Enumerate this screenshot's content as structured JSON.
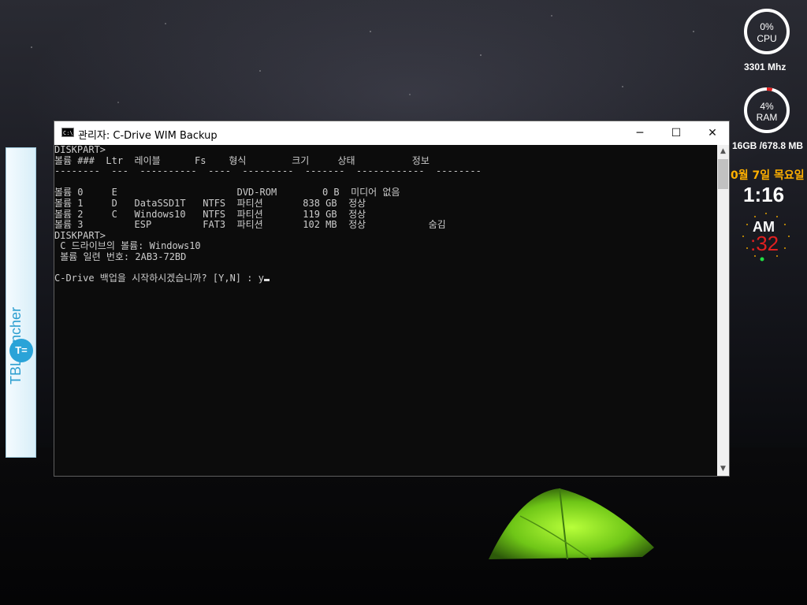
{
  "launcher": {
    "label": "TBLauncher"
  },
  "console_window": {
    "title": "관리자:  C-Drive WIM Backup",
    "minimize": "─",
    "maximize": "☐",
    "close": "✕",
    "lines": [
      "DISKPART>",
      "볼륨 ###  Ltr  레이블      Fs    형식        크기     상태          정보",
      "--------  ---  ----------  ----  ---------  -------  ------------  --------",
      "",
      "볼륨 0     E                     DVD-ROM        0 B  미디어 없음",
      "볼륨 1     D   DataSSD1T   NTFS  파티션       838 GB  정상",
      "볼륨 2     C   Windows10   NTFS  파티션       119 GB  정상",
      "볼륨 3         ESP         FAT3  파티션       102 MB  정상           숨김",
      "DISKPART>",
      " C 드라이브의 볼륨: Windows10",
      " 볼륨 일련 번호: 2AB3-72BD",
      "",
      "C-Drive 백업을 시작하시겠습니까? [Y,N] : y"
    ]
  },
  "gadgets": {
    "cpu": {
      "percent_label": "0%",
      "name": "CPU",
      "speed": "3301 Mhz",
      "usage": 0
    },
    "ram": {
      "percent_label": "4%",
      "name": "RAM",
      "memory": "16GB /678.8 MB",
      "usage": 4
    },
    "clock": {
      "date": "0월 7일 목요일",
      "time": "1:16",
      "ampm": "AM",
      "seconds": ":32"
    },
    "colors": {
      "ring": "#ffffff",
      "ring_used": "#e02020",
      "date": "#ffb000",
      "seconds": "#e02020"
    }
  }
}
